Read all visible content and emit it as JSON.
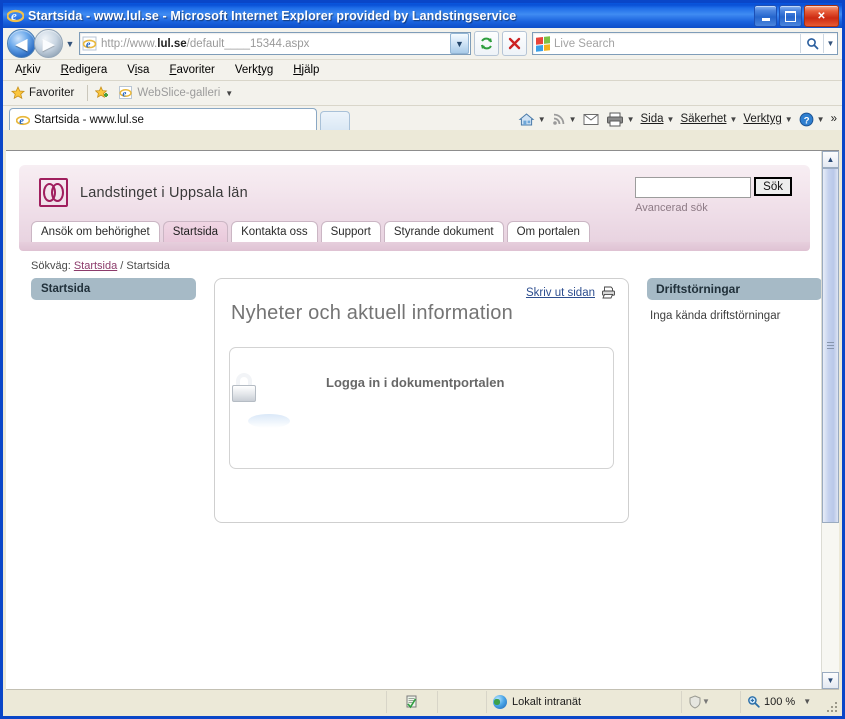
{
  "window": {
    "title": "Startsida - www.lul.se - Microsoft Internet Explorer provided by Landstingservice",
    "minimize_label": "Minimera",
    "maximize_label": "Maximera",
    "close_label": "Stäng"
  },
  "toolbar": {
    "back_label": "Tillbaka",
    "forward_label": "Framåt",
    "history_label": "Senaste sidor",
    "address_value": "http://www.",
    "address_host_bold": "lul.se",
    "address_rest": "/default____15344.aspx",
    "address_full": "http://www.lul.se/default____15344.aspx",
    "refresh_label": "Uppdatera",
    "stop_label": "Stoppa",
    "search_placeholder": "Live Search",
    "search_value": "",
    "search_go_label": "Sök"
  },
  "menubar": {
    "items": [
      {
        "pre": "A",
        "accel": "r",
        "post": "kiv",
        "label": "Arkiv"
      },
      {
        "pre": "",
        "accel": "R",
        "post": "edigera",
        "label": "Redigera"
      },
      {
        "pre": "V",
        "accel": "i",
        "post": "sa",
        "label": "Visa"
      },
      {
        "pre": "",
        "accel": "F",
        "post": "avoriter",
        "label": "Favoriter"
      },
      {
        "pre": "Verk",
        "accel": "t",
        "post": "yg",
        "label": "Verktyg"
      },
      {
        "pre": "",
        "accel": "H",
        "post": "jälp",
        "label": "Hjälp"
      }
    ]
  },
  "favoritesbar": {
    "favorites_label": "Favoriter",
    "webslice_label": "WebSlice-galleri"
  },
  "tabstrip": {
    "tab_title": "Startsida - www.lul.se",
    "new_tab_label": "Ny flik",
    "commands": [
      {
        "name": "home",
        "label": ""
      },
      {
        "name": "feeds",
        "label": ""
      },
      {
        "name": "mail",
        "label": ""
      },
      {
        "name": "print",
        "label": ""
      },
      {
        "name": "page",
        "label": "Sida"
      },
      {
        "name": "safety",
        "label": "Säkerhet"
      },
      {
        "name": "tools",
        "label": "Verktyg"
      },
      {
        "name": "help",
        "label": ""
      }
    ],
    "overflow_label": "»"
  },
  "page": {
    "site_name": "Landstinget i Uppsala län",
    "search": {
      "value": "",
      "button_label": "Sök",
      "advanced_label": "Avancerad sök"
    },
    "nav_tabs": [
      {
        "label": "Ansök om behörighet",
        "active": false
      },
      {
        "label": "Startsida",
        "active": true
      },
      {
        "label": "Kontakta oss",
        "active": false
      },
      {
        "label": "Support",
        "active": false
      },
      {
        "label": "Styrande dokument",
        "active": false
      },
      {
        "label": "Om portalen",
        "active": false
      }
    ],
    "breadcrumb": {
      "prefix": "Sökväg:",
      "link": "Startsida",
      "separator": "/",
      "current": "Startsida"
    },
    "sidebar": {
      "items": [
        {
          "label": "Startsida"
        }
      ]
    },
    "content": {
      "print_link": "Skriv ut sidan",
      "title": "Nyheter och aktuell information",
      "login_card": {
        "label": "Logga in i dokumentportalen"
      }
    },
    "right": {
      "card_title": "Driftstörningar",
      "card_text": "Inga kända driftstörningar"
    }
  },
  "statusbar": {
    "zone_label": "Lokalt intranät",
    "zoom_label": "100 %",
    "protected_label": ""
  },
  "colors": {
    "brand_magenta": "#a01f5e",
    "header_pink": "#eddbe6",
    "card_blue_grey": "#a6bac6",
    "title_blue": "#0a50d6",
    "link_blue": "#2d4e8f",
    "crumb_link": "#8c3b6b"
  }
}
